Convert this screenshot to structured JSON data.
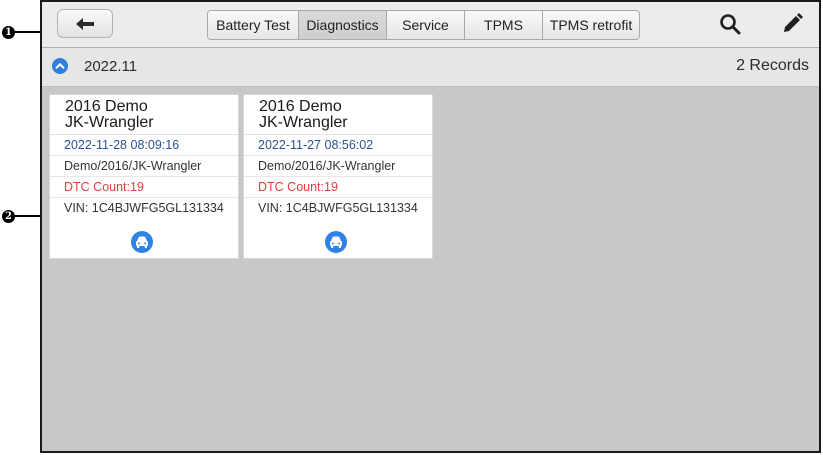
{
  "callouts": {
    "one": "1",
    "two": "2"
  },
  "toolbar": {
    "tabs": [
      {
        "label": "Battery Test",
        "active": false
      },
      {
        "label": "Diagnostics",
        "active": true
      },
      {
        "label": "Service",
        "active": false
      },
      {
        "label": "TPMS",
        "active": false
      },
      {
        "label": "TPMS retrofit",
        "active": false
      }
    ],
    "icons": [
      "back-arrow-icon",
      "search-icon",
      "edit-pencil-icon"
    ]
  },
  "group": {
    "month": "2022.11",
    "records": "2 Records",
    "expand_icon": "chevron-up-icon"
  },
  "cards": [
    {
      "title_line1": "2016 Demo",
      "title_line2": "JK-Wrangler",
      "datetime": "2022-11-28 08:09:16",
      "path": "Demo/2016/JK-Wrangler",
      "dtc": "DTC Count:19",
      "vin": "VIN: 1C4BJWFG5GL131334",
      "icon": "car-icon"
    },
    {
      "title_line1": "2016 Demo",
      "title_line2": "JK-Wrangler",
      "datetime": "2022-11-27 08:56:02",
      "path": "Demo/2016/JK-Wrangler",
      "dtc": "DTC Count:19",
      "vin": "VIN: 1C4BJWFG5GL131334",
      "icon": "car-icon"
    }
  ],
  "colors": {
    "accent_blue": "#2f83e6",
    "dtc_red": "#e23d3d",
    "date_blue": "#2b5292"
  }
}
